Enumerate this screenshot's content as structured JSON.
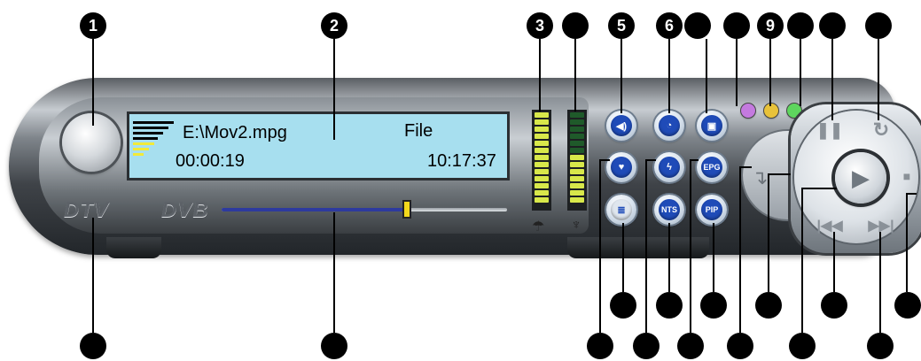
{
  "lcd": {
    "filename": "E:\\Mov2.mpg",
    "source": "File",
    "elapsed": "00:00:19",
    "clock": "10:17:37"
  },
  "logos": {
    "dtv": "DTV",
    "dvb": "DVB"
  },
  "seek": {
    "position_fraction": 0.64
  },
  "meters": {
    "left_level_fraction": 1.0,
    "right_level_fraction": 0.55
  },
  "markers": {
    "top": [
      "1",
      "2",
      "3",
      "",
      "5",
      "6",
      "",
      "",
      "9",
      "",
      ""
    ],
    "bottom": [
      "",
      "",
      "",
      "",
      "",
      "",
      "",
      "",
      "",
      "",
      ""
    ]
  },
  "buttons": {
    "mute_icon": "speaker-icon",
    "timer_icon": "stopwatch-icon",
    "snapshot_icon": "camera-icon",
    "favorite_icon": "heart-icon",
    "instant_icon": "lightning-icon",
    "epg_label": "EPG",
    "list_icon": "list-icon",
    "nts_label": "NTS",
    "pip_label": "PIP",
    "record_icon": "record-icon",
    "pause_icon": "pause-icon",
    "repeat_icon": "repeat-icon",
    "play_icon": "play-icon",
    "stop_icon": "stop-icon",
    "prev_icon": "previous-icon",
    "next_icon": "next-icon",
    "mini_icon": "minimize-icon"
  },
  "colors": {
    "lcd": "#a7dfef",
    "meter_on": "#d8e84a",
    "meter_off": "#1f5a2a",
    "button_blue": "#1f4bb8",
    "dot_purple": "#c47adf",
    "dot_yellow": "#e8c23a",
    "dot_green": "#5ed65e",
    "record_red": "#e0202a"
  }
}
